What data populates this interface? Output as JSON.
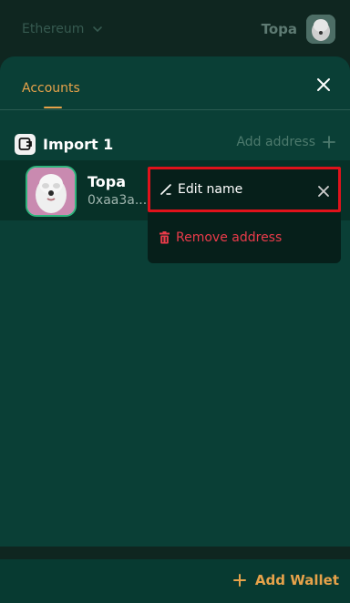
{
  "topbar": {
    "network": "Ethereum",
    "account_name": "Topa"
  },
  "panel": {
    "tab": "Accounts"
  },
  "wallet": {
    "name": "Import 1",
    "add_address": "Add address"
  },
  "account": {
    "name": "Topa",
    "address": "0xaa3a..."
  },
  "menu": {
    "edit": "Edit name",
    "remove": "Remove address"
  },
  "footer": {
    "add_wallet": "Add Wallet"
  },
  "colors": {
    "accent": "#e6a24a",
    "danger": "#ea3b4a",
    "highlight": "#e0121b"
  }
}
